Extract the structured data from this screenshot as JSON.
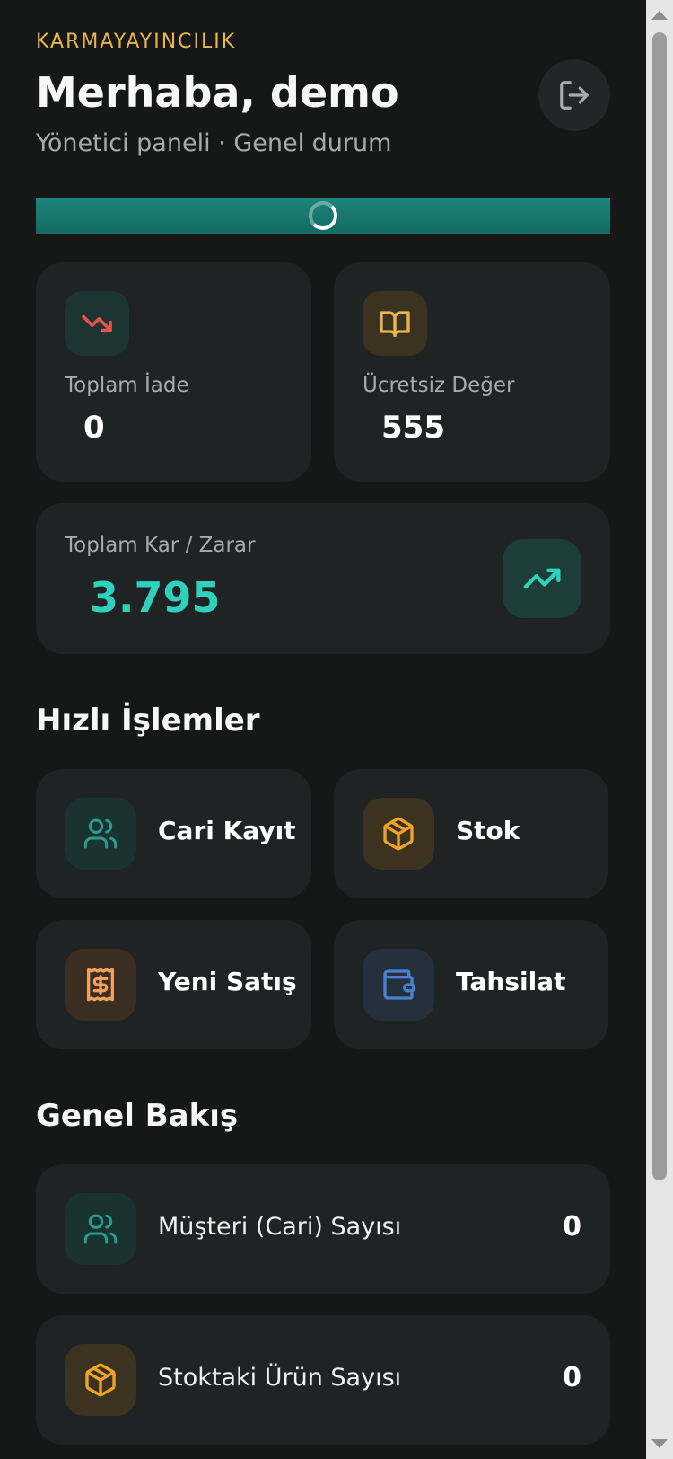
{
  "header": {
    "brand": "KARMAYAYINCILIK",
    "greeting": "Merhaba, demo",
    "subtitle": "Yönetici paneli · Genel durum",
    "logout_icon": "logout-icon"
  },
  "stats": [
    {
      "label": "Toplam İade",
      "value": "0",
      "icon": "trending-down-icon",
      "color": "#e5534b"
    },
    {
      "label": "Ücretsiz Değer",
      "value": "555",
      "icon": "open-book-icon",
      "color": "#e8b64a"
    }
  ],
  "profit": {
    "label": "Toplam Kar / Zarar",
    "value": "3.795",
    "icon": "trending-up-icon",
    "color": "#2fd1bd"
  },
  "quick_actions": {
    "title": "Hızlı İşlemler",
    "items": [
      {
        "label": "Cari Kayıt",
        "icon": "users-icon",
        "color": "#2a9d8f"
      },
      {
        "label": "Stok",
        "icon": "package-icon",
        "color": "#f0a32a"
      },
      {
        "label": "Yeni Satış",
        "icon": "receipt-dollar-icon",
        "color": "#f0a15a"
      },
      {
        "label": "Tahsilat",
        "icon": "wallet-icon",
        "color": "#4a7fd1"
      }
    ]
  },
  "overview": {
    "title": "Genel Bakış",
    "items": [
      {
        "label": "Müşteri (Cari) Sayısı",
        "value": "0",
        "icon": "users-icon"
      },
      {
        "label": "Stoktaki Ürün Sayısı",
        "value": "0",
        "icon": "package-icon"
      }
    ]
  }
}
